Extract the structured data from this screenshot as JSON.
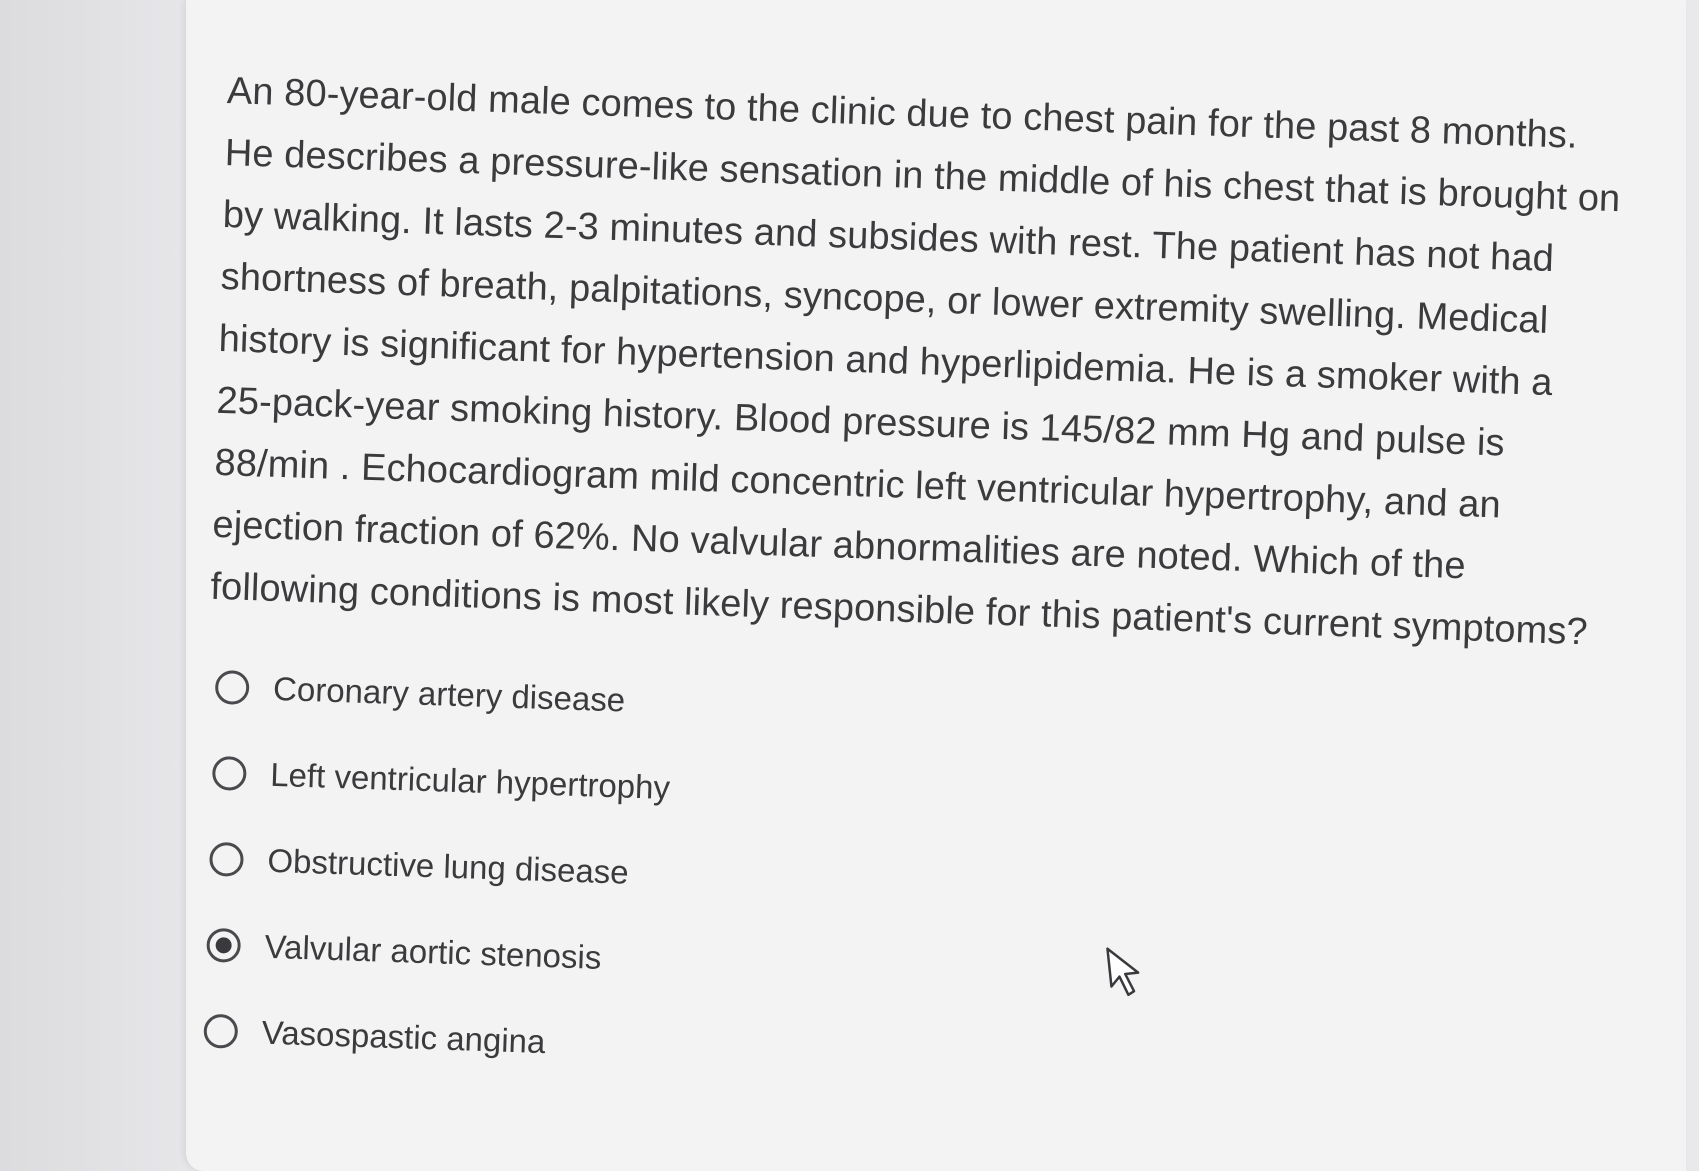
{
  "question": {
    "text": "An 80-year-old male comes to the clinic due to chest pain for the past 8 months. He describes a pressure-like sensation in the middle of his chest that is brought on by walking. It lasts 2-3 minutes and subsides with rest. The patient has not had shortness of breath, palpitations, syncope, or lower extremity swelling. Medical history is significant for hypertension and hyperlipidemia. He is a smoker with a 25-pack-year smoking history. Blood pressure is 145/82 mm Hg and pulse is 88/min . Echocardiogram mild concentric left ventricular hypertrophy, and an ejection fraction of 62%. No valvular abnormalities are noted. Which of the following conditions is most likely responsible for this patient's current symptoms?"
  },
  "options": [
    {
      "label": "Coronary artery disease",
      "selected": false
    },
    {
      "label": "Left ventricular hypertrophy",
      "selected": false
    },
    {
      "label": "Obstructive lung disease",
      "selected": false
    },
    {
      "label": "Valvular aortic stenosis",
      "selected": true
    },
    {
      "label": "Vasospastic angina",
      "selected": false
    }
  ],
  "colors": {
    "text": "#3b3b3e",
    "card_background": "#f3f3f3",
    "radio_border": "#4a4a4e"
  },
  "icons": {
    "radio_unselected": "radio-empty-icon",
    "radio_selected": "radio-filled-icon",
    "pointer": "mouse-pointer-icon"
  }
}
